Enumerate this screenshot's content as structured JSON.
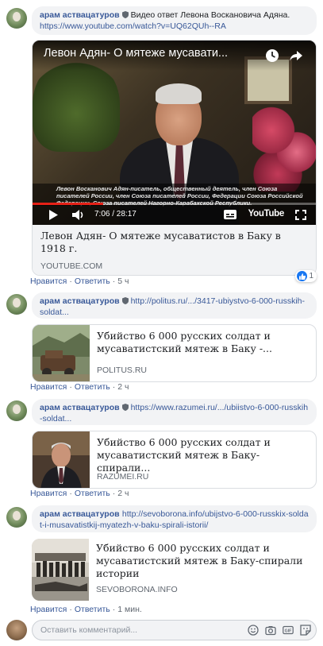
{
  "comments": [
    {
      "author": "арам аствацатуров",
      "text": "Видео ответ Левона Восканoвича Адяна.",
      "link": "https://www.youtube.com/watch?v=UQ62QUh--RA",
      "actions": {
        "like": "Нравится",
        "reply": "Ответить",
        "time": "5 ч"
      },
      "reactions": "1",
      "preview": {
        "video_title": "Левон Адян- О мятеже мусавати...",
        "caption": "Левон Восканович Адян-писатель, общественный деятель, член Союза писателей России, член Союза писателей России, Федерации Союза Российской Федерации, Союза писателей Нагорно-Карабахской Республики.",
        "time": "7:06 / 28:17",
        "progress": 0.25,
        "yt_label": "YouTube",
        "title": "Левон Адян- О мятеже мусаватистов в Баку в 1918 г.",
        "domain": "YOUTUBE.COM"
      }
    },
    {
      "author": "арам аствацатуров",
      "link": "http://politus.ru/.../3417-ubiystvo-6-000-russkih-soldat...",
      "actions": {
        "like": "Нравится",
        "reply": "Ответить",
        "time": "2 ч"
      },
      "preview": {
        "title": "Убийство 6 000 русских солдат и мусаватистский мятеж в Баку -...",
        "domain": "POLITUS.RU"
      }
    },
    {
      "author": "арам аствацатуров",
      "link": "https://www.razumei.ru/.../ubiistvo-6-000-russkih-soldat...",
      "actions": {
        "like": "Нравится",
        "reply": "Ответить",
        "time": "2 ч"
      },
      "preview": {
        "title": "Убийство 6 000 русских солдат и мусаватистский мятеж в Баку-спирали...",
        "domain": "RAZUMEI.RU"
      }
    },
    {
      "author": "арам аствацатуров",
      "link": "http://sevoborona.info/ubijstvo-6-000-russkix-soldat-i-musavatistkij-myatezh-v-baku-spirali-istorii/",
      "actions": {
        "like": "Нравится",
        "reply": "Ответить",
        "time": "1 мин."
      },
      "preview": {
        "title": "Убийство 6 000 русских солдат и мусаватистский мятеж в Баку-спирали истории",
        "domain": "SEVOBORONA.INFO"
      }
    }
  ],
  "composer": {
    "placeholder": "Оставить комментарий..."
  },
  "icons": {
    "verified": "shield-icon",
    "play": "play-icon",
    "volume": "volume-icon",
    "clock": "watch-later-icon",
    "share": "share-icon",
    "cc": "captions-icon",
    "fullscreen": "fullscreen-icon",
    "like": "thumbs-up-icon",
    "emoji": "emoji-icon",
    "camera": "camera-icon",
    "gif": "gif-icon",
    "sticker": "sticker-icon"
  },
  "colors": {
    "link": "#385898",
    "bubble": "#f2f3f5",
    "like": "#1877f2",
    "progress": "#e62117"
  }
}
